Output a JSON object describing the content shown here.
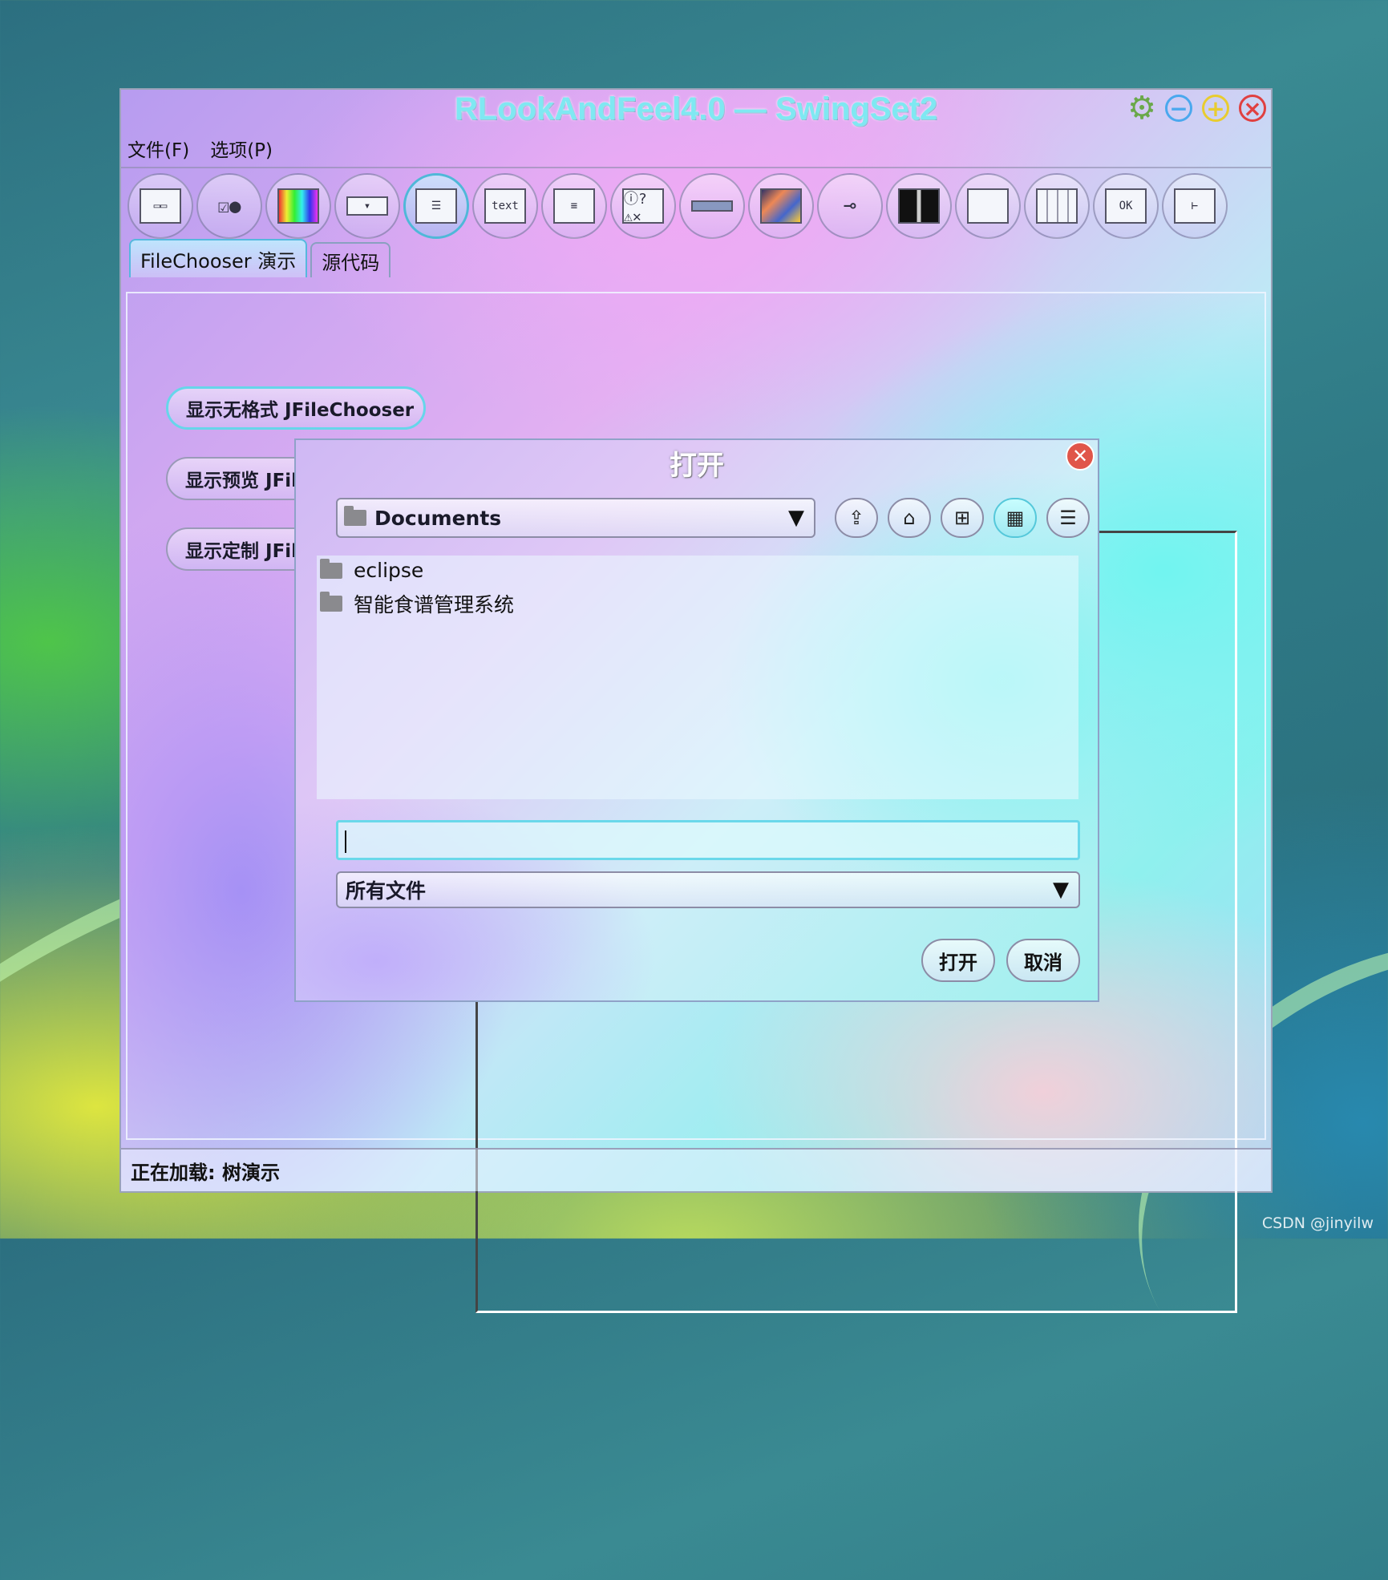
{
  "window": {
    "title": "RLookAndFeel4.0 — SwingSet2",
    "controls": {
      "settings": "gear-icon",
      "minimize": "−",
      "maximize": "+",
      "close": "×"
    }
  },
  "menubar": {
    "file": "文件(F)",
    "options": "选项(P)"
  },
  "toolbar": {
    "items": [
      {
        "icon": "internal-frame-icon"
      },
      {
        "icon": "buttons-icon"
      },
      {
        "icon": "color-chooser-icon"
      },
      {
        "icon": "combobox-icon"
      },
      {
        "icon": "file-chooser-icon",
        "selected": true
      },
      {
        "icon": "editor-pane-icon",
        "text": "text"
      },
      {
        "icon": "list-icon"
      },
      {
        "icon": "option-pane-icon"
      },
      {
        "icon": "progress-bar-icon"
      },
      {
        "icon": "scroll-pane-icon"
      },
      {
        "icon": "slider-icon"
      },
      {
        "icon": "split-pane-icon"
      },
      {
        "icon": "tabbed-pane-icon"
      },
      {
        "icon": "table-icon"
      },
      {
        "icon": "tooltip-icon",
        "text": "OK"
      },
      {
        "icon": "tree-icon"
      }
    ]
  },
  "tabs": {
    "demo": "FileChooser 演示",
    "source": "源代码"
  },
  "demo_buttons": {
    "plain": "显示无格式 JFileChooser",
    "preview": "显示预览 JFileChooser",
    "custom": "显示定制 JFileChooser"
  },
  "status": "正在加载: 树演示",
  "dialog": {
    "title": "打开",
    "look_in": "Documents",
    "files": [
      {
        "name": "eclipse",
        "type": "folder"
      },
      {
        "name": "智能食谱管理系统",
        "type": "folder"
      }
    ],
    "filename_value": "",
    "filter": "所有文件",
    "open_button": "打开",
    "cancel_button": "取消"
  },
  "watermark": "CSDN @jinyilw"
}
